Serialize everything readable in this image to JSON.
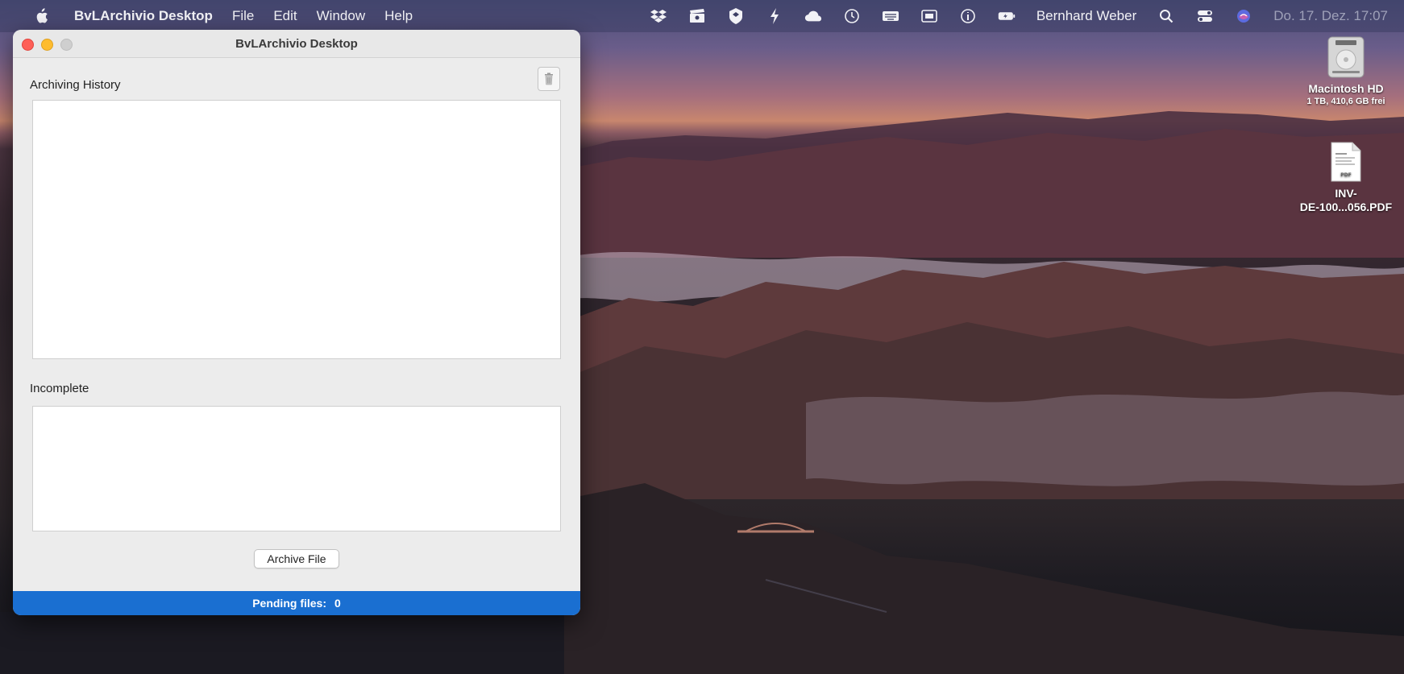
{
  "menubar": {
    "app_name": "BvLArchivio Desktop",
    "menus": [
      "File",
      "Edit",
      "Window",
      "Help"
    ],
    "user_name": "Bernhard Weber",
    "clock": "Do. 17. Dez.  17:07"
  },
  "desktop_icons": {
    "disk": {
      "label": "Macintosh HD",
      "sub": "1 TB, 410,6 GB frei"
    },
    "pdf": {
      "label_line1": "INV-",
      "label_line2": "DE-100...056.PDF",
      "badge": "PDF"
    }
  },
  "window": {
    "title": "BvLArchivio Desktop",
    "archiving_history_label": "Archiving History",
    "incomplete_label": "Incomplete",
    "archive_button_label": "Archive File",
    "status_label": "Pending files:",
    "pending_count": "0"
  }
}
